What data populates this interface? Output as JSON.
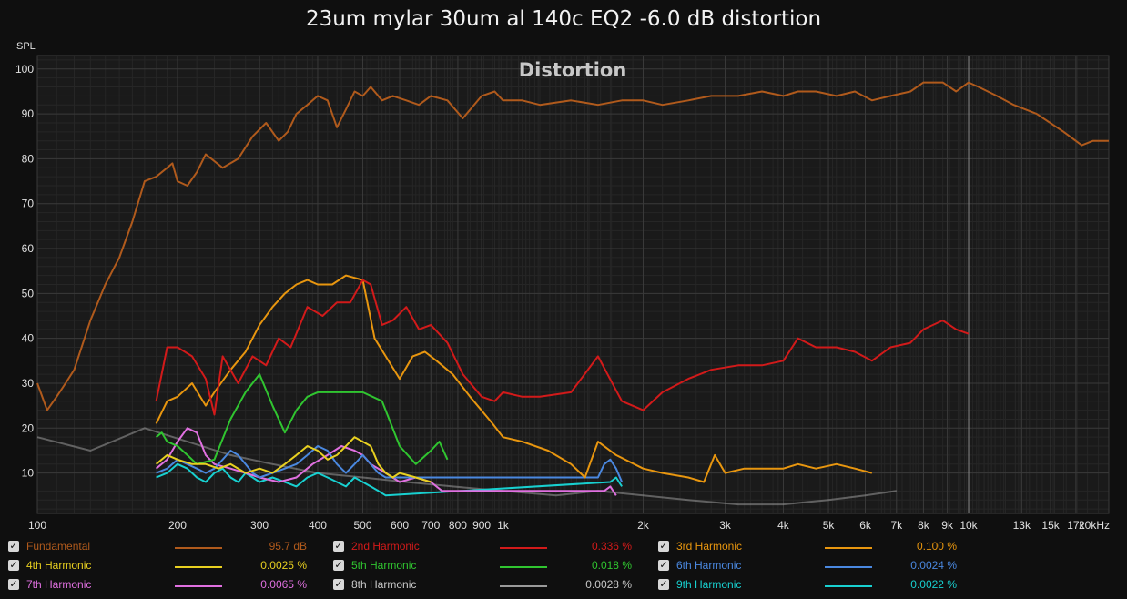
{
  "chart_data": {
    "type": "line",
    "title": "23um mylar 30um al 140c EQ2 -6.0 dB distortion",
    "subtitle": "Distortion",
    "ylabel": "SPL",
    "xscale": "log",
    "xlim": [
      100,
      20000
    ],
    "ylim": [
      1,
      103
    ],
    "grid": true,
    "y_ticks": [
      10,
      20,
      30,
      40,
      50,
      60,
      70,
      80,
      90,
      100
    ],
    "x_ticks": [
      {
        "v": 100,
        "t": "100"
      },
      {
        "v": 200,
        "t": "200"
      },
      {
        "v": 300,
        "t": "300"
      },
      {
        "v": 400,
        "t": "400"
      },
      {
        "v": 500,
        "t": "500"
      },
      {
        "v": 600,
        "t": "600"
      },
      {
        "v": 700,
        "t": "700"
      },
      {
        "v": 800,
        "t": "800"
      },
      {
        "v": 900,
        "t": "900"
      },
      {
        "v": 1000,
        "t": "1k"
      },
      {
        "v": 2000,
        "t": "2k"
      },
      {
        "v": 3000,
        "t": "3k"
      },
      {
        "v": 4000,
        "t": "4k"
      },
      {
        "v": 5000,
        "t": "5k"
      },
      {
        "v": 6000,
        "t": "6k"
      },
      {
        "v": 7000,
        "t": "7k"
      },
      {
        "v": 8000,
        "t": "8k"
      },
      {
        "v": 9000,
        "t": "9k"
      },
      {
        "v": 10000,
        "t": "10k"
      },
      {
        "v": 13000,
        "t": "13k"
      },
      {
        "v": 15000,
        "t": "15k"
      },
      {
        "v": 17000,
        "t": "17k"
      },
      {
        "v": 20000,
        "t": "20kHz"
      }
    ],
    "series": [
      {
        "name": "Fundamental",
        "value": "95.7 dB",
        "color": "#b05a1c",
        "x": [
          100,
          105,
          110,
          115,
          120,
          130,
          140,
          150,
          160,
          170,
          180,
          190,
          195,
          200,
          210,
          220,
          230,
          250,
          270,
          290,
          310,
          330,
          345,
          360,
          380,
          400,
          420,
          440,
          460,
          480,
          500,
          520,
          550,
          580,
          620,
          660,
          700,
          760,
          820,
          900,
          960,
          1000,
          1100,
          1200,
          1400,
          1600,
          1800,
          2000,
          2200,
          2500,
          2800,
          3200,
          3600,
          4000,
          4300,
          4700,
          5200,
          5700,
          6200,
          6800,
          7500,
          8000,
          8800,
          9400,
          10000,
          10500,
          11500,
          12500,
          14000,
          16000,
          17500,
          18500,
          20000
        ],
        "y": [
          30,
          24,
          27,
          30,
          33,
          44,
          52,
          58,
          66,
          75,
          76,
          78,
          79,
          75,
          74,
          77,
          81,
          78,
          80,
          85,
          88,
          84,
          86,
          90,
          92,
          94,
          93,
          87,
          91,
          95,
          94,
          96,
          93,
          94,
          93,
          92,
          94,
          93,
          89,
          94,
          95,
          93,
          93,
          92,
          93,
          92,
          93,
          93,
          92,
          93,
          94,
          94,
          95,
          94,
          95,
          95,
          94,
          95,
          93,
          94,
          95,
          97,
          97,
          95,
          97,
          96,
          94,
          92,
          90,
          86,
          83,
          84,
          84
        ]
      },
      {
        "name": "2nd Harmonic",
        "value": "0.336 %",
        "color": "#d21a1a",
        "x": [
          180,
          190,
          200,
          215,
          230,
          240,
          250,
          270,
          290,
          310,
          330,
          350,
          380,
          410,
          440,
          470,
          500,
          520,
          550,
          580,
          620,
          660,
          700,
          760,
          820,
          900,
          960,
          1000,
          1100,
          1200,
          1400,
          1600,
          1800,
          2000,
          2200,
          2500,
          2800,
          3200,
          3600,
          4000,
          4300,
          4700,
          5200,
          5700,
          6200,
          6800,
          7500,
          8000,
          8800,
          9400,
          10000
        ],
        "y": [
          26,
          38,
          38,
          36,
          31,
          23,
          36,
          30,
          36,
          34,
          40,
          38,
          47,
          45,
          48,
          48,
          53,
          52,
          43,
          44,
          47,
          42,
          43,
          39,
          32,
          27,
          26,
          28,
          27,
          27,
          28,
          36,
          26,
          24,
          28,
          31,
          33,
          34,
          34,
          35,
          40,
          38,
          38,
          37,
          35,
          38,
          39,
          42,
          44,
          42,
          41
        ]
      },
      {
        "name": "3rd Harmonic",
        "value": "0.100 %",
        "color": "#e8960f",
        "x": [
          180,
          190,
          200,
          215,
          230,
          240,
          260,
          280,
          300,
          320,
          340,
          360,
          380,
          400,
          430,
          460,
          500,
          530,
          560,
          600,
          640,
          680,
          720,
          780,
          850,
          950,
          1000,
          1100,
          1250,
          1400,
          1500,
          1600,
          1750,
          2000,
          2200,
          2500,
          2700,
          2850,
          3000,
          3300,
          3600,
          4000,
          4300,
          4700,
          5200,
          5700,
          6200
        ],
        "y": [
          21,
          26,
          27,
          30,
          25,
          28,
          33,
          37,
          43,
          47,
          50,
          52,
          53,
          52,
          52,
          54,
          53,
          40,
          36,
          31,
          36,
          37,
          35,
          32,
          27,
          21,
          18,
          17,
          15,
          12,
          9,
          17,
          14,
          11,
          10,
          9,
          8,
          14,
          10,
          11,
          11,
          11,
          12,
          11,
          12,
          11,
          10
        ]
      },
      {
        "name": "4th Harmonic",
        "value": "0.0025 %",
        "color": "#e8d020",
        "x": [
          180,
          190,
          200,
          215,
          230,
          245,
          260,
          280,
          300,
          320,
          340,
          360,
          380,
          400,
          420,
          440,
          460,
          480,
          500,
          520,
          540,
          560,
          580,
          600,
          650,
          700
        ],
        "y": [
          12,
          14,
          13,
          12,
          12,
          11,
          12,
          10,
          11,
          10,
          12,
          14,
          16,
          15,
          13,
          14,
          16,
          18,
          17,
          16,
          12,
          10,
          9,
          10,
          9,
          8
        ]
      },
      {
        "name": "5th Harmonic",
        "value": "0.018 %",
        "color": "#30c530",
        "x": [
          180,
          185,
          190,
          200,
          210,
          220,
          240,
          260,
          280,
          300,
          320,
          340,
          360,
          380,
          400,
          450,
          500,
          550,
          600,
          650,
          700,
          730,
          760
        ],
        "y": [
          18,
          19,
          17,
          16,
          14,
          12,
          13,
          22,
          28,
          32,
          25,
          19,
          24,
          27,
          28,
          28,
          28,
          26,
          16,
          12,
          15,
          17,
          13
        ]
      },
      {
        "name": "6th Harmonic",
        "value": "0.0024 %",
        "color": "#4a88e0",
        "x": [
          180,
          190,
          200,
          210,
          220,
          230,
          240,
          250,
          260,
          270,
          280,
          290,
          300,
          320,
          340,
          360,
          380,
          400,
          420,
          440,
          460,
          480,
          500,
          520,
          540,
          560,
          1600,
          1650,
          1700,
          1750,
          1800
        ],
        "y": [
          10,
          11,
          13,
          12,
          11,
          10,
          11,
          13,
          15,
          14,
          12,
          10,
          9,
          10,
          11,
          12,
          14,
          16,
          15,
          12,
          10,
          12,
          14,
          12,
          10,
          9,
          9,
          12,
          13,
          11,
          8
        ]
      },
      {
        "name": "7th Harmonic",
        "value": "0.0065 %",
        "color": "#e070e0",
        "x": [
          180,
          190,
          200,
          210,
          220,
          230,
          240,
          260,
          280,
          300,
          330,
          360,
          390,
          420,
          450,
          480,
          500,
          520,
          560,
          600,
          650,
          700,
          740,
          1650,
          1700,
          1750
        ],
        "y": [
          11,
          13,
          17,
          20,
          19,
          14,
          12,
          11,
          10,
          9,
          8,
          9,
          12,
          14,
          16,
          15,
          14,
          12,
          10,
          8,
          9,
          8,
          6,
          6,
          7,
          5
        ]
      },
      {
        "name": "8th Harmonic",
        "value": "0.0028 %",
        "color": "#9a9a9a",
        "x": [
          100,
          130,
          170,
          210,
          260,
          320,
          400,
          500,
          620,
          780,
          1000,
          1300,
          1600,
          2000,
          2500,
          3200,
          4000,
          5000,
          6000,
          7000
        ],
        "y": [
          18,
          15,
          20,
          17,
          14,
          12,
          10,
          9,
          8,
          7,
          6,
          5,
          6,
          5,
          4,
          3,
          3,
          4,
          5,
          6
        ]
      },
      {
        "name": "9th Harmonic",
        "value": "0.0022 %",
        "color": "#18d0d0",
        "x": [
          180,
          190,
          200,
          210,
          220,
          230,
          240,
          250,
          260,
          270,
          280,
          290,
          300,
          320,
          340,
          360,
          380,
          400,
          420,
          440,
          460,
          480,
          500,
          520,
          540,
          560,
          1700,
          1750,
          1800
        ],
        "y": [
          9,
          10,
          12,
          11,
          9,
          8,
          10,
          11,
          9,
          8,
          10,
          9,
          8,
          9,
          8,
          7,
          9,
          10,
          9,
          8,
          7,
          9,
          8,
          7,
          6,
          5,
          8,
          9,
          7
        ]
      }
    ]
  },
  "legend": [
    {
      "name": "Fundamental",
      "value": "95.7 dB",
      "color": "#b05a1c"
    },
    {
      "name": "2nd Harmonic",
      "value": "0.336 %",
      "color": "#d21a1a"
    },
    {
      "name": "3rd Harmonic",
      "value": "0.100 %",
      "color": "#e8960f"
    },
    {
      "name": "4th Harmonic",
      "value": "0.0025 %",
      "color": "#e8d020"
    },
    {
      "name": "5th Harmonic",
      "value": "0.018 %",
      "color": "#30c530"
    },
    {
      "name": "6th Harmonic",
      "value": "0.0024 %",
      "color": "#4a88e0"
    },
    {
      "name": "7th Harmonic",
      "value": "0.0065 %",
      "color": "#e070e0"
    },
    {
      "name": "8th Harmonic",
      "value": "0.0028 %",
      "color": "#9a9a9a"
    },
    {
      "name": "9th Harmonic",
      "value": "0.0022 %",
      "color": "#18d0d0"
    }
  ],
  "checkbox_mark": "✓"
}
